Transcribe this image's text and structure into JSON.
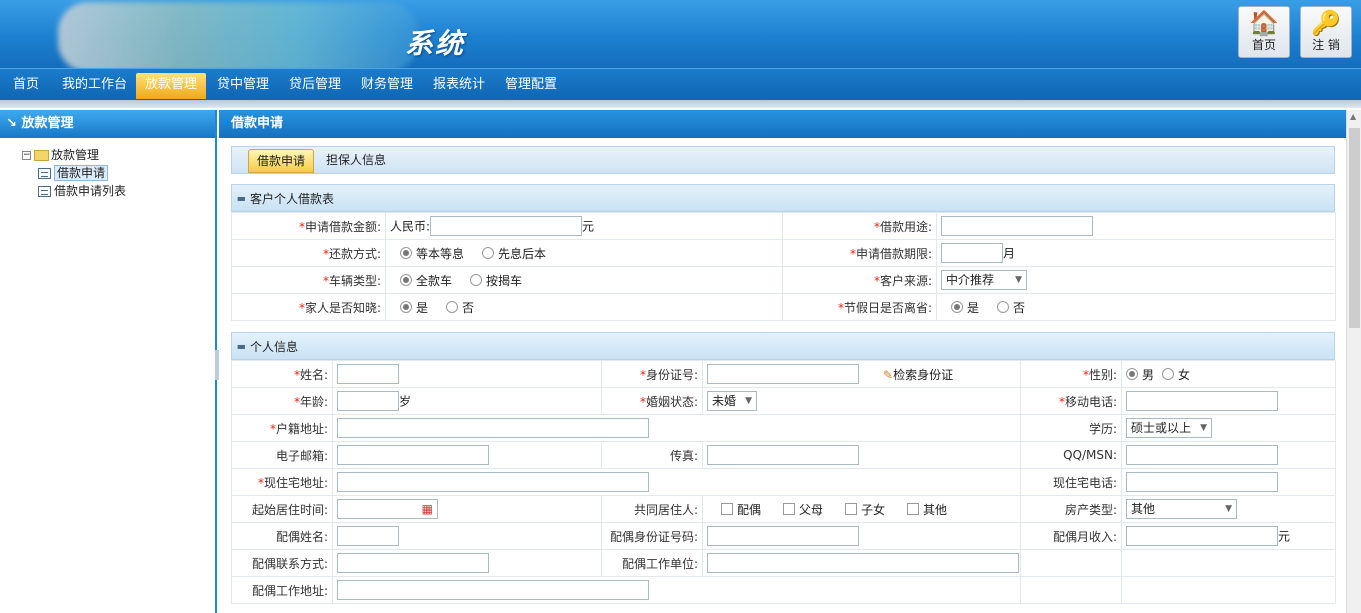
{
  "header": {
    "system_title": "系统",
    "home_label": "首页",
    "logout_label": "注 销"
  },
  "main_nav": [
    {
      "label": "首页"
    },
    {
      "label": "我的工作台"
    },
    {
      "label": "放款管理",
      "active": true
    },
    {
      "label": "贷中管理"
    },
    {
      "label": "贷后管理"
    },
    {
      "label": "财务管理"
    },
    {
      "label": "报表统计"
    },
    {
      "label": "管理配置"
    }
  ],
  "sidebar": {
    "title": "放款管理",
    "tree_root": "放款管理",
    "items": [
      {
        "label": "借款申请",
        "selected": true
      },
      {
        "label": "借款申请列表"
      }
    ]
  },
  "content": {
    "title": "借款申请",
    "tabs": [
      {
        "label": "借款申请",
        "active": true
      },
      {
        "label": "担保人信息"
      }
    ],
    "loan_section": {
      "title": "客户个人借款表",
      "amount_label": "申请借款金额:",
      "currency_prefix": "人民币:",
      "currency_unit": "元",
      "purpose_label": "借款用途:",
      "repay_label": "还款方式:",
      "repay_options": [
        "等本等息",
        "先息后本"
      ],
      "term_label": "申请借款期限:",
      "term_unit": "月",
      "vehicle_label": "车辆类型:",
      "vehicle_options": [
        "全款车",
        "按揭车"
      ],
      "source_label": "客户来源:",
      "source_value": "中介推荐",
      "family_label": "家人是否知晓:",
      "holiday_label": "节假日是否离省:",
      "yes": "是",
      "no": "否"
    },
    "personal_section": {
      "title": "个人信息",
      "name_label": "姓名:",
      "id_label": "身份证号:",
      "search_id": "检索身份证",
      "gender_label": "性别:",
      "gender_male": "男",
      "gender_female": "女",
      "age_label": "年龄:",
      "age_unit": "岁",
      "marital_label": "婚姻状态:",
      "marital_value": "未婚",
      "mobile_label": "移动电话:",
      "hukou_label": "户籍地址:",
      "education_label": "学历:",
      "education_value": "硕士或以上",
      "email_label": "电子邮箱:",
      "fax_label": "传真:",
      "qq_label": "QQ/MSN:",
      "address_label": "现住宅地址:",
      "home_phone_label": "现住宅电话:",
      "start_time_label": "起始居住时间:",
      "cohabit_label": "共同居住人:",
      "cohabit_options": [
        "配偶",
        "父母",
        "子女",
        "其他"
      ],
      "property_label": "房产类型:",
      "property_value": "其他",
      "spouse_name_label": "配偶姓名:",
      "spouse_id_label": "配偶身份证号码:",
      "spouse_income_label": "配偶月收入:",
      "spouse_income_unit": "元",
      "spouse_contact_label": "配偶联系方式:",
      "spouse_company_label": "配偶工作单位:",
      "spouse_work_addr_label": "配偶工作地址:"
    }
  }
}
